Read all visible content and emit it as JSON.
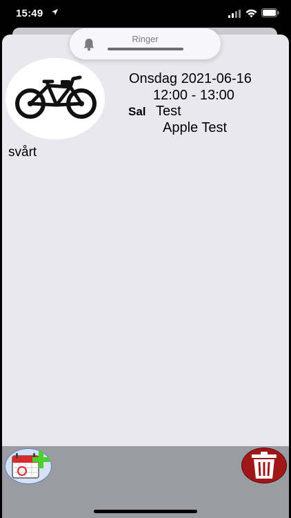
{
  "status_bar": {
    "time": "15:49"
  },
  "ringer": {
    "label": "Ringer",
    "level_fraction": 1.0
  },
  "event": {
    "date": "Onsdag 2021-06-16",
    "time_range": "12:00 - 13:00",
    "sal_label": "Sal",
    "sal_value": "Test",
    "organizer": "Apple Test",
    "description": "svårt",
    "image_icon": "bicycle-icon"
  },
  "toolbar": {
    "add_icon": "calendar-add-icon",
    "delete_icon": "trash-icon"
  },
  "colors": {
    "sheet": "#e9e8ee",
    "bottom_bar": "#9b9ba4",
    "trash": "#a11616",
    "add_plus": "#49d12e"
  }
}
